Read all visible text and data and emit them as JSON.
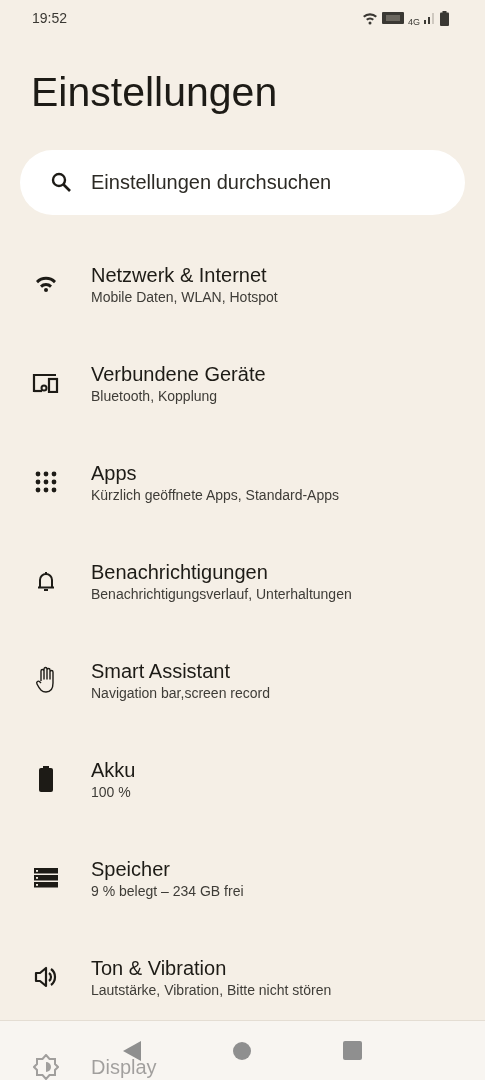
{
  "status_bar": {
    "time": "19:52",
    "network_label": "4G"
  },
  "title": "Einstellungen",
  "search": {
    "placeholder": "Einstellungen durchsuchen"
  },
  "items": [
    {
      "kind": "wifi",
      "title": "Netzwerk & Internet",
      "subtitle": "Mobile Daten, WLAN, Hotspot"
    },
    {
      "kind": "devices",
      "title": "Verbundene Geräte",
      "subtitle": "Bluetooth, Kopplung"
    },
    {
      "kind": "apps",
      "title": "Apps",
      "subtitle": "Kürzlich geöffnete Apps, Standard-Apps"
    },
    {
      "kind": "bell",
      "title": "Benachrichtigungen",
      "subtitle": "Benachrichtigungsverlauf, Unterhaltungen"
    },
    {
      "kind": "hand",
      "title": "Smart Assistant",
      "subtitle": "Navigation bar,screen record"
    },
    {
      "kind": "battery",
      "title": "Akku",
      "subtitle": "100 %"
    },
    {
      "kind": "storage",
      "title": "Speicher",
      "subtitle": "9 % belegt – 234 GB frei"
    },
    {
      "kind": "sound",
      "title": "Ton & Vibration",
      "subtitle": "Lautstärke, Vibration, Bitte nicht stören"
    },
    {
      "kind": "display",
      "title": "Display"
    }
  ]
}
